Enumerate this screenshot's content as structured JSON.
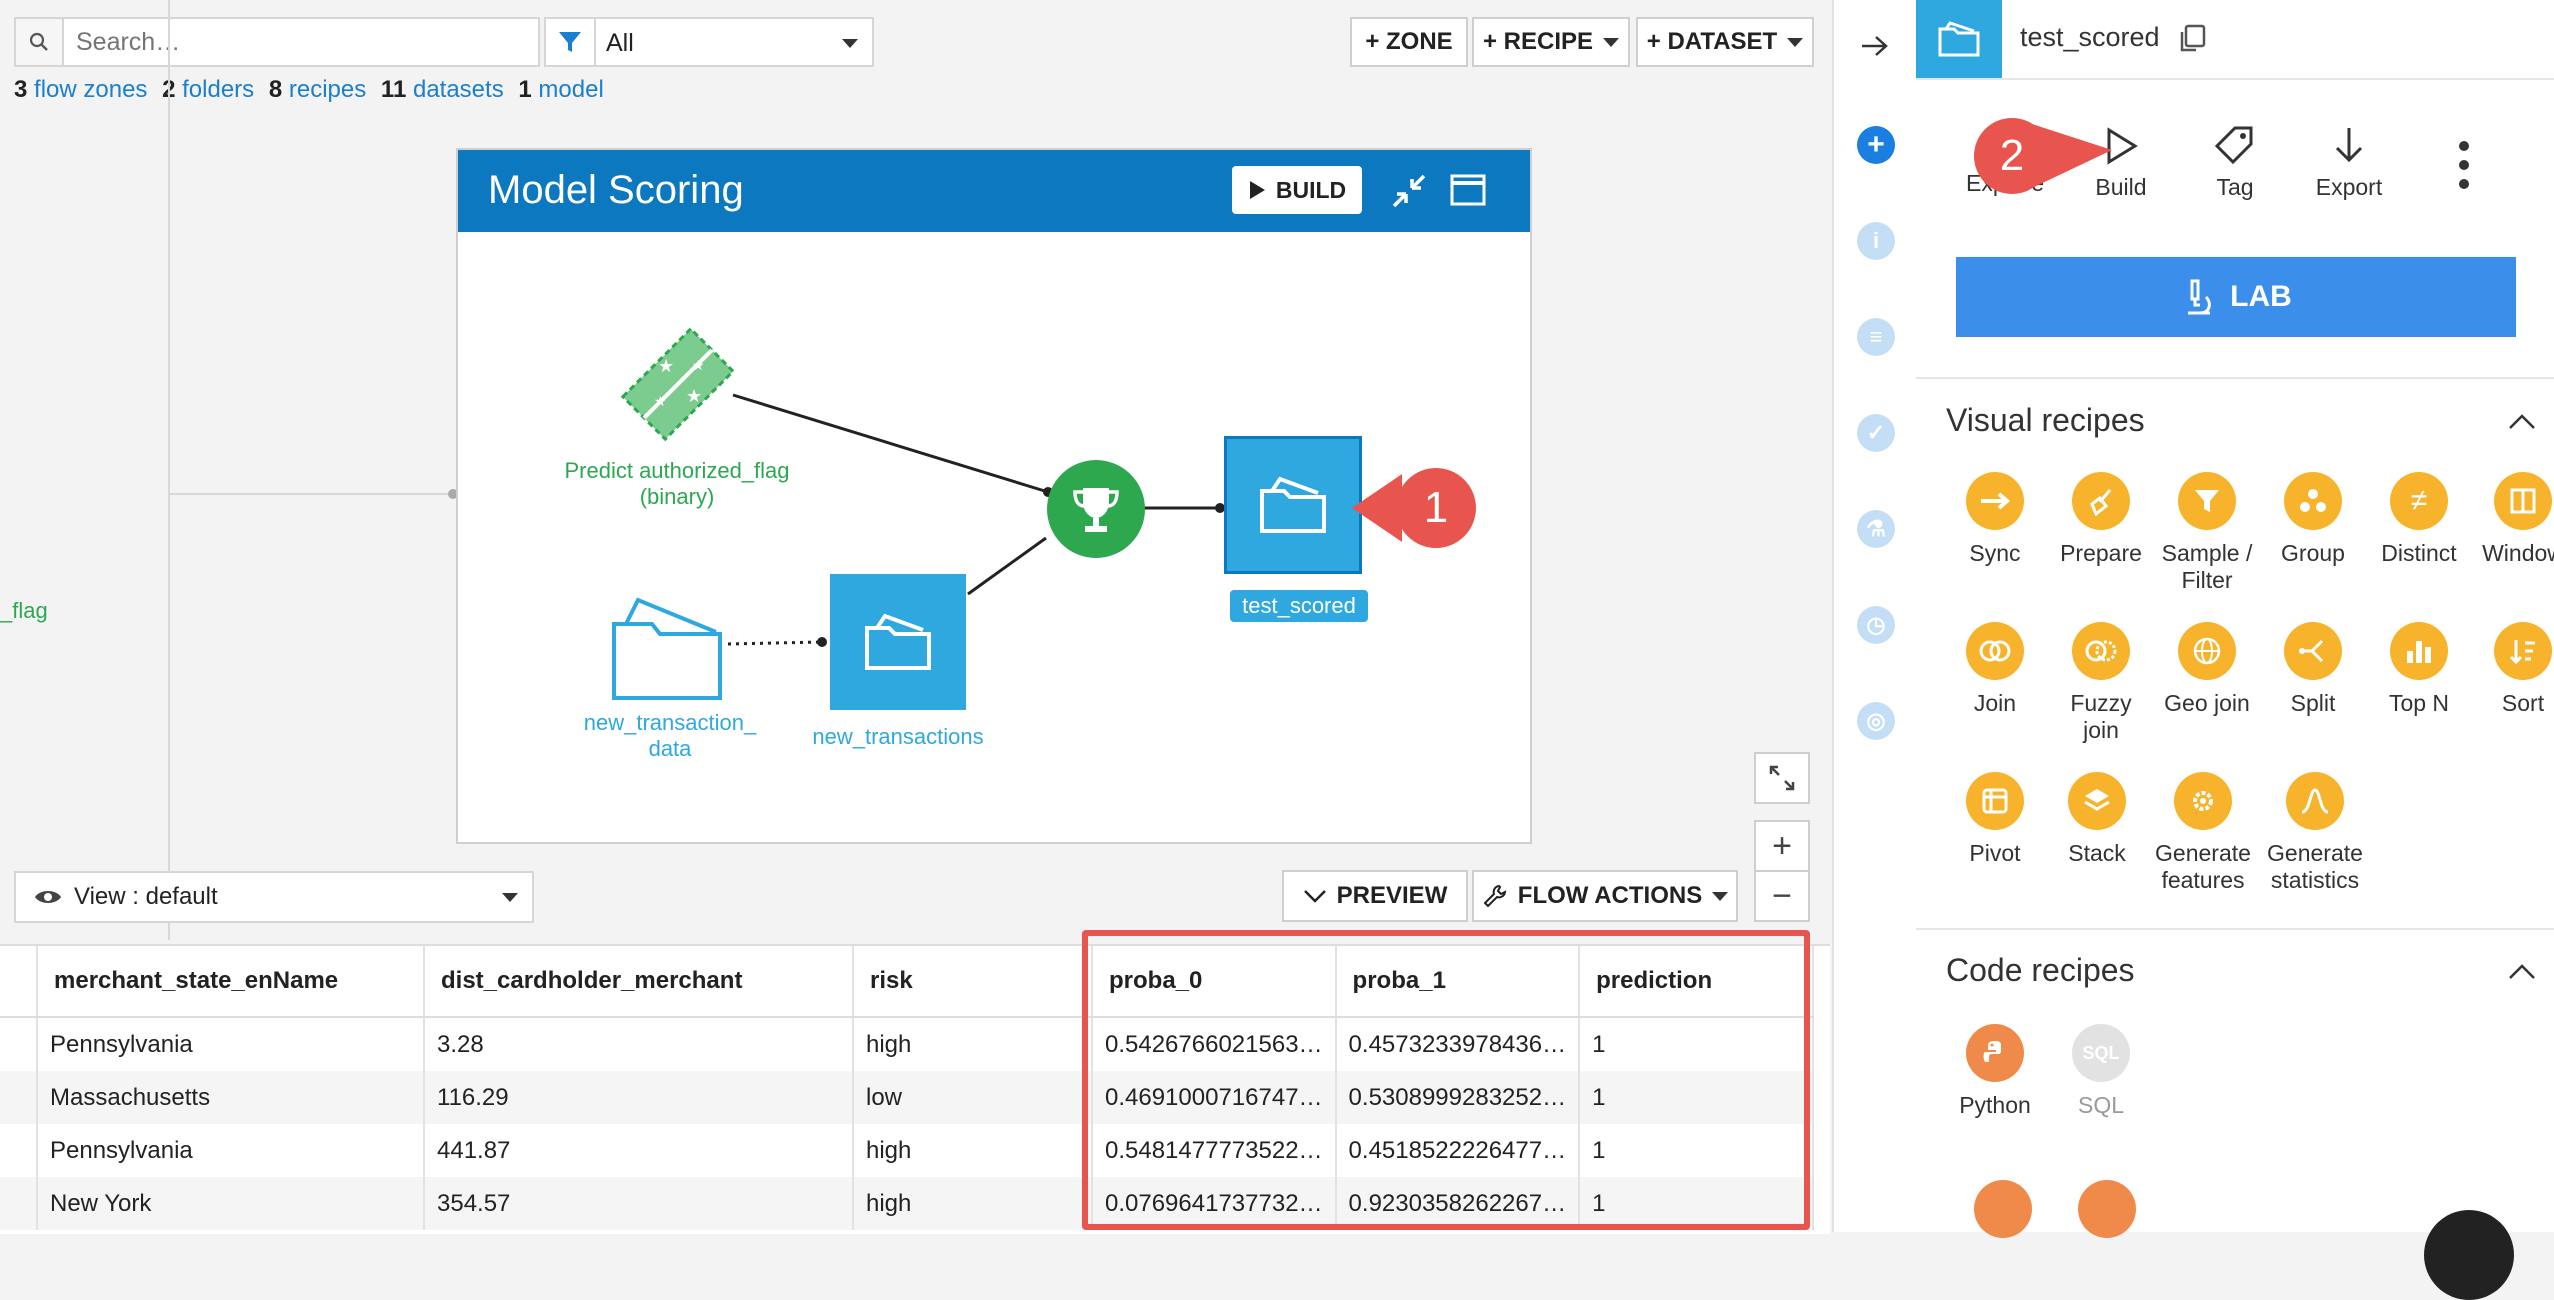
{
  "toolbar": {
    "search_placeholder": "Search…",
    "filter_value": "All",
    "zone_button": "+ ZONE",
    "recipe_button": "+ RECIPE",
    "dataset_button": "+ DATASET"
  },
  "stats": [
    {
      "count": "3",
      "label": "flow zones"
    },
    {
      "count": "2",
      "label": "folders"
    },
    {
      "count": "8",
      "label": "recipes"
    },
    {
      "count": "11",
      "label": "datasets"
    },
    {
      "count": "1",
      "label": "model"
    }
  ],
  "left_fragment": "_flag",
  "zone": {
    "title": "Model Scoring",
    "build_label": "BUILD",
    "nodes": {
      "model_label": "Predict authorized_flag (binary)",
      "folder_label": "new_transaction_ data",
      "dataset_label": "new_transactions",
      "output_label": "test_scored"
    }
  },
  "callouts": {
    "one": "1",
    "two": "2"
  },
  "bottom_bar": {
    "view_label": "View : default",
    "preview_label": "PREVIEW",
    "flow_actions_label": "FLOW ACTIONS"
  },
  "table": {
    "headers": [
      "merchant_state_enName",
      "dist_cardholder_merchant",
      "risk",
      "proba_0",
      "proba_1",
      "prediction"
    ],
    "rows": [
      [
        "Pennsylvania",
        "3.28",
        "high",
        "0.5426766021563…",
        "0.4573233978436…",
        "1"
      ],
      [
        "Massachusetts",
        "116.29",
        "low",
        "0.4691000716747…",
        "0.5308999283252…",
        "1"
      ],
      [
        "Pennsylvania",
        "441.87",
        "high",
        "0.5481477773522…",
        "0.4518522226477…",
        "1"
      ],
      [
        "New York",
        "354.57",
        "high",
        "0.0769641737732…",
        "0.9230358262267…",
        "1"
      ]
    ]
  },
  "panel": {
    "dataset_name": "test_scored",
    "actions": [
      "Explore",
      "Build",
      "Tag",
      "Export"
    ],
    "lab_label": "LAB",
    "visual_recipes_title": "Visual recipes",
    "visual_recipes": [
      [
        "Sync",
        ""
      ],
      [
        "Prepare",
        ""
      ],
      [
        "Sample /",
        "Filter"
      ],
      [
        "Group",
        ""
      ],
      [
        "Distinct",
        ""
      ],
      [
        "Window",
        ""
      ],
      [
        "Join",
        ""
      ],
      [
        "Fuzzy",
        "join"
      ],
      [
        "Geo join",
        ""
      ],
      [
        "Split",
        ""
      ],
      [
        "Top N",
        ""
      ],
      [
        "Sort",
        ""
      ],
      [
        "Pivot",
        ""
      ],
      [
        "Stack",
        ""
      ],
      [
        "Generate",
        "features"
      ],
      [
        "Generate",
        "statistics"
      ]
    ],
    "code_recipes_title": "Code recipes",
    "code_recipes": [
      "Python",
      "SQL"
    ]
  },
  "colors": {
    "accent_blue": "#0c78bf",
    "dataset_blue": "#2ea8df",
    "model_green": "#2da84f",
    "recipe_orange": "#f7b32b",
    "callout_red": "#e8554e",
    "lab_blue": "#3b8eea"
  }
}
